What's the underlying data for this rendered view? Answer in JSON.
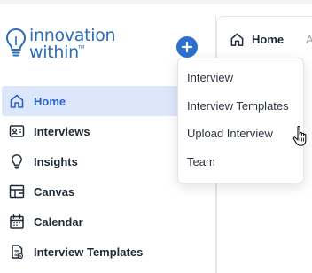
{
  "brand": {
    "line1": "innovation",
    "line2": "within",
    "tm": "TM",
    "color": "#2b6cb8"
  },
  "accent": "#2b6fd0",
  "active_bg": "#dde7fb",
  "add_button": {
    "symbol": "+",
    "icon": "plus-icon"
  },
  "sidebar": {
    "items": [
      {
        "label": "Home",
        "icon": "home-icon",
        "active": true
      },
      {
        "label": "Interviews",
        "icon": "id-card-icon",
        "active": false
      },
      {
        "label": "Insights",
        "icon": "lightbulb-icon",
        "active": false
      },
      {
        "label": "Canvas",
        "icon": "canvas-icon",
        "active": false
      },
      {
        "label": "Calendar",
        "icon": "calendar-icon",
        "active": false
      },
      {
        "label": "Interview Templates",
        "icon": "template-icon",
        "active": false
      }
    ]
  },
  "tabs": [
    {
      "label": "Home",
      "icon": "home-icon"
    },
    {
      "label": "A",
      "partial": true
    }
  ],
  "dropdown": {
    "items": [
      "Interview",
      "Interview Templates",
      "Upload Interview",
      "Team"
    ],
    "hovered": "Upload Interview"
  }
}
